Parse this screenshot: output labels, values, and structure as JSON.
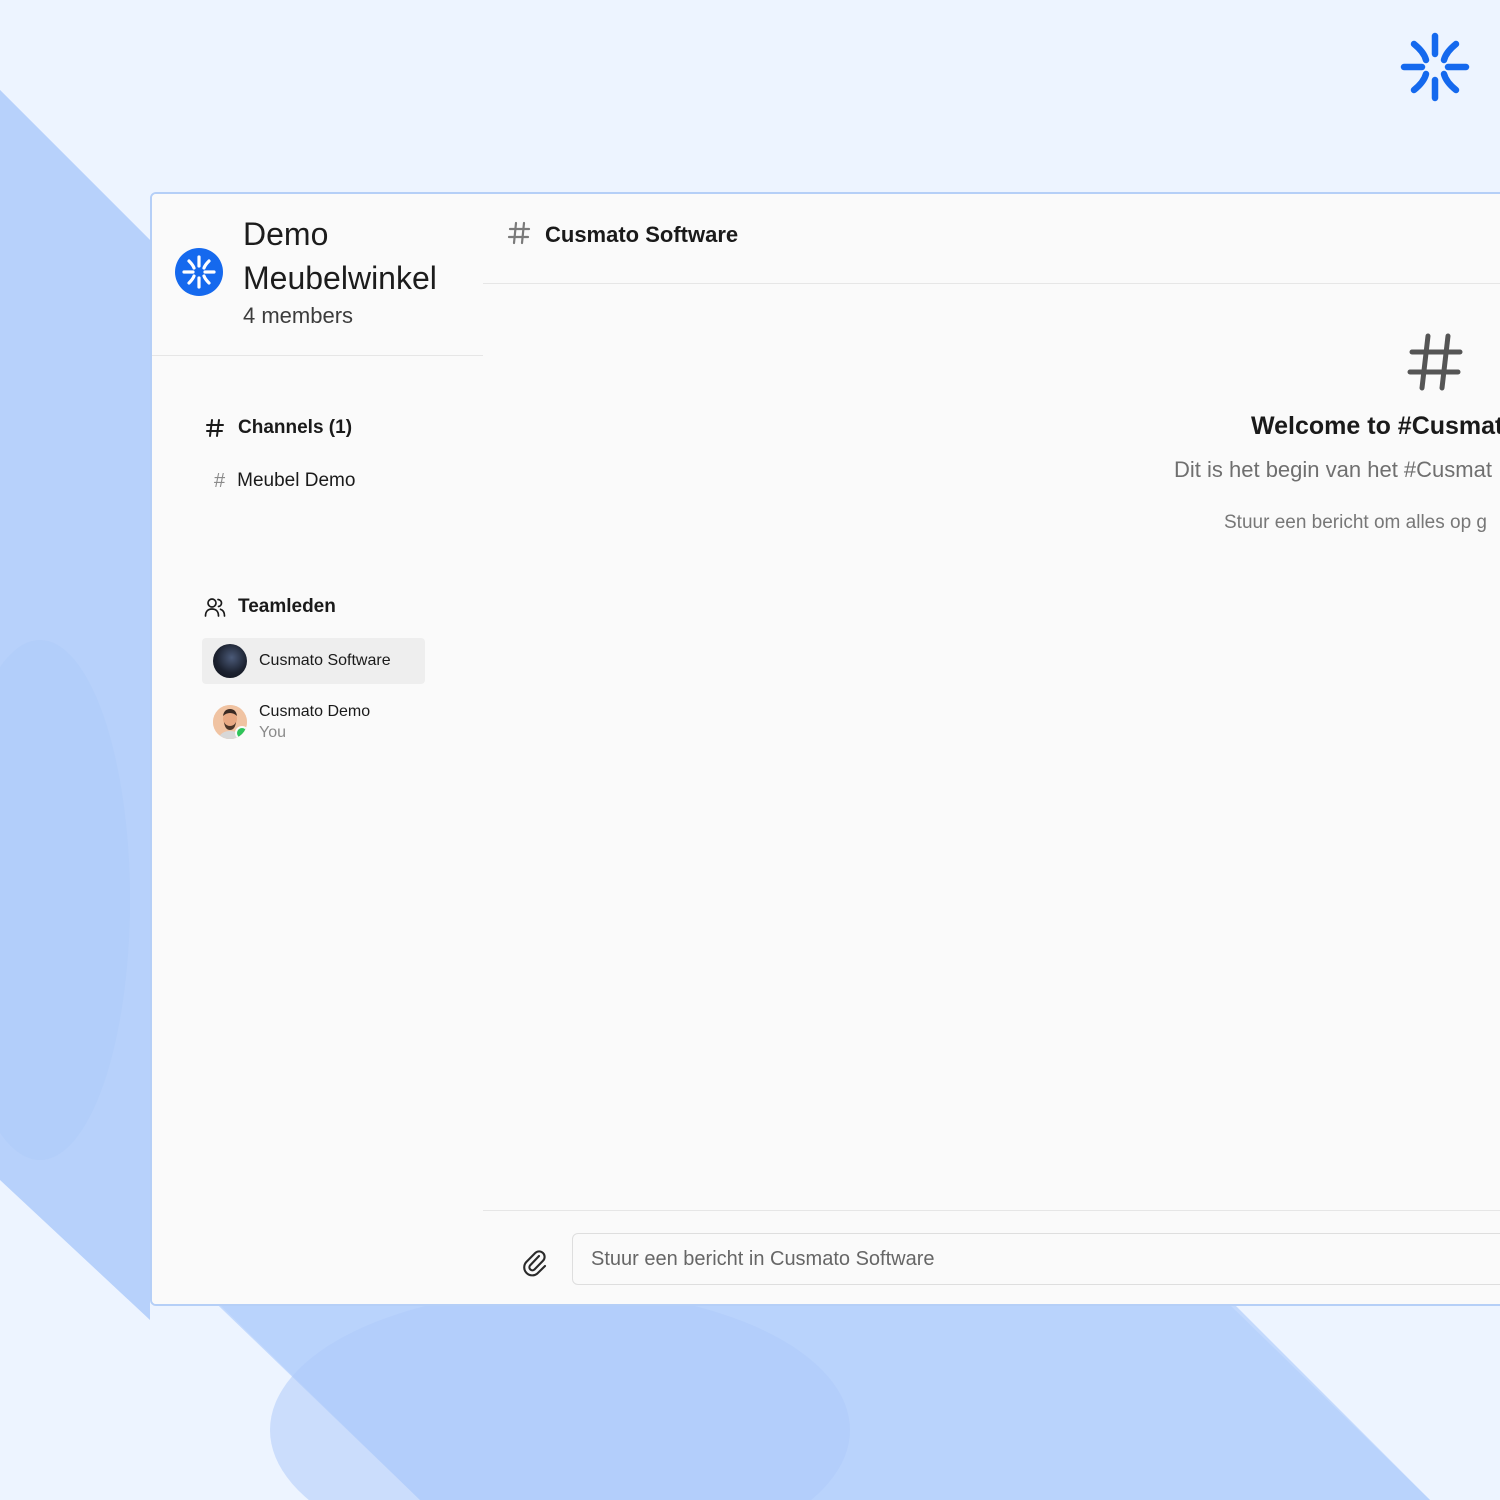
{
  "brand": {
    "icon": "asterisk-burst-icon",
    "accent_color": "#1569ee"
  },
  "workspace": {
    "name": "Demo Meubelwinkel",
    "members_label": "4 members"
  },
  "sidebar": {
    "channels_title": "Channels (1)",
    "channels": [
      {
        "label": "Meubel Demo"
      }
    ],
    "team_title": "Teamleden",
    "members": [
      {
        "name": "Cusmato Software",
        "subtitle": "",
        "active": true,
        "online": false
      },
      {
        "name": "Cusmato Demo",
        "subtitle": "You",
        "active": false,
        "online": true
      }
    ]
  },
  "channel": {
    "title": "Cusmato Software",
    "welcome_title": "Welcome to #Cusmato",
    "welcome_subtitle": "Dit is het begin van het #Cusmat",
    "welcome_hint": "Stuur een bericht om alles op g"
  },
  "composer": {
    "placeholder": "Stuur een bericht in Cusmato Software",
    "value": ""
  }
}
